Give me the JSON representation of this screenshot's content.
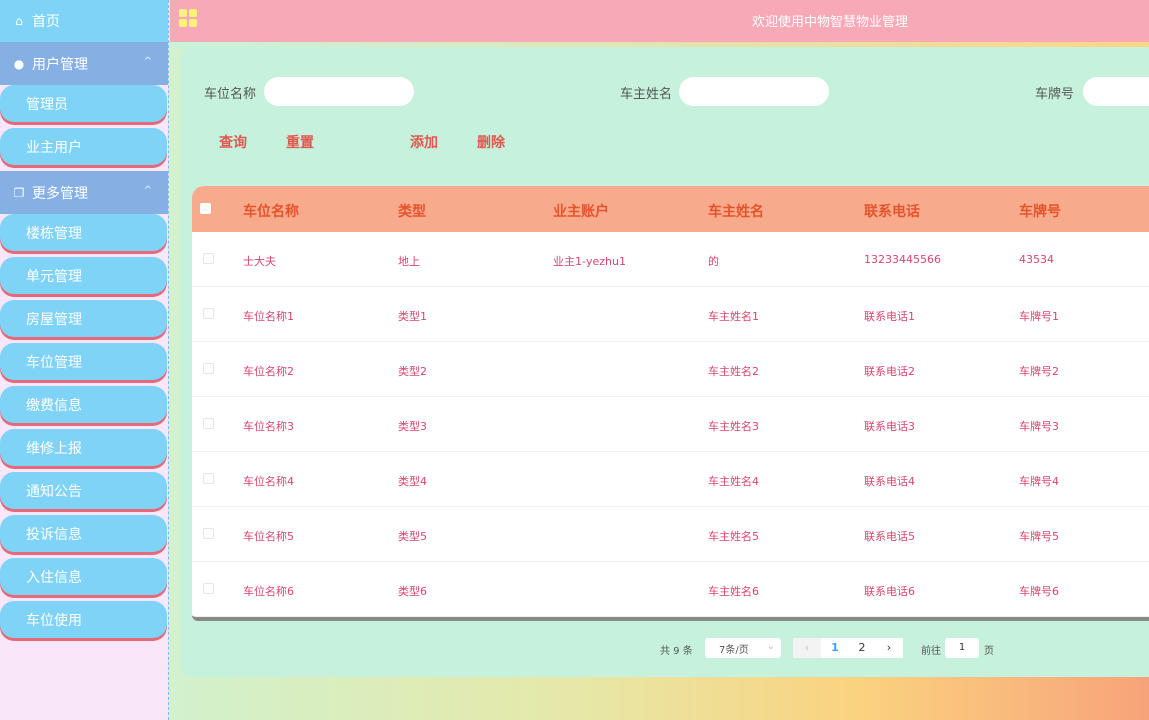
{
  "sidebar": {
    "home": "首页",
    "group_user": "用户管理",
    "user_items": [
      "管理员",
      "业主用户"
    ],
    "group_more": "更多管理",
    "more_items": [
      "楼栋管理",
      "单元管理",
      "房屋管理",
      "车位管理",
      "缴费信息",
      "维修上报",
      "通知公告",
      "投诉信息",
      "入住信息",
      "车位使用"
    ]
  },
  "header": {
    "title": "欢迎使用中物智慧物业管理"
  },
  "search": {
    "label_name": "车位名称",
    "label_owner": "车主姓名",
    "label_plate": "车牌号"
  },
  "buttons": {
    "query": "查询",
    "reset": "重置",
    "add": "添加",
    "delete": "删除"
  },
  "table": {
    "headers": [
      "车位名称",
      "类型",
      "业主账户",
      "车主姓名",
      "联系电话",
      "车牌号"
    ],
    "rows": [
      [
        "士大夫",
        "地上",
        "业主1-yezhu1",
        "的",
        "13233445566",
        "43534"
      ],
      [
        "车位名称1",
        "类型1",
        "",
        "车主姓名1",
        "联系电话1",
        "车牌号1"
      ],
      [
        "车位名称2",
        "类型2",
        "",
        "车主姓名2",
        "联系电话2",
        "车牌号2"
      ],
      [
        "车位名称3",
        "类型3",
        "",
        "车主姓名3",
        "联系电话3",
        "车牌号3"
      ],
      [
        "车位名称4",
        "类型4",
        "",
        "车主姓名4",
        "联系电话4",
        "车牌号4"
      ],
      [
        "车位名称5",
        "类型5",
        "",
        "车主姓名5",
        "联系电话5",
        "车牌号5"
      ],
      [
        "车位名称6",
        "类型6",
        "",
        "车主姓名6",
        "联系电话6",
        "车牌号6"
      ]
    ]
  },
  "pagination": {
    "total": "共 9 条",
    "page_size": "7条/页",
    "pages": [
      "1",
      "2"
    ],
    "goto_label": "前往",
    "goto_value": "1",
    "page_suffix": "页"
  }
}
